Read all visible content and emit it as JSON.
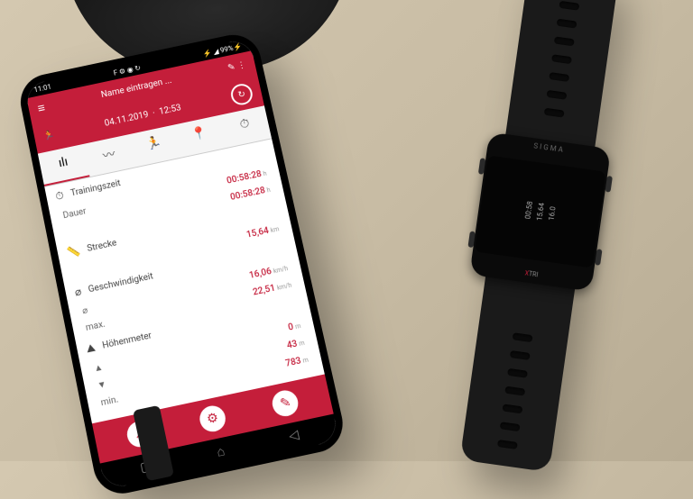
{
  "phone": {
    "status": {
      "time": "11:01",
      "icons": "F ⚙ ◉ ↻",
      "right": "⚡ ◢ 99%⚡"
    },
    "header": {
      "title": "Name eintragen ...",
      "right_icons": "✎ ⋮"
    },
    "datebar": {
      "date": "04.11.2019",
      "time": "12:53"
    },
    "tabs": [
      "ılı",
      "〰",
      "🏃",
      "📍",
      "⏱"
    ],
    "sections": [
      {
        "icon": "⏱",
        "title": "Trainingszeit",
        "rows": [
          {
            "label": "Dauer",
            "value": "00:58:28",
            "unit": "h"
          },
          {
            "label": "",
            "value": "00:58:28",
            "unit": "h"
          }
        ]
      },
      {
        "icon": "📏",
        "title": "Strecke",
        "rows": [
          {
            "label": "",
            "value": "15,64",
            "unit": "km"
          }
        ]
      },
      {
        "icon": "⌀",
        "title": "Geschwindigkeit",
        "rows": [
          {
            "label": "⌀",
            "value": "16,06",
            "unit": "km/h"
          },
          {
            "label": "max.",
            "value": "22,51",
            "unit": "km/h"
          }
        ]
      },
      {
        "icon": "⛰",
        "title": "Höhenmeter",
        "rows": [
          {
            "label": "▲",
            "value": "0",
            "unit": "m"
          },
          {
            "label": "▼",
            "value": "43",
            "unit": "m"
          },
          {
            "label": "min.",
            "value": "783",
            "unit": "m"
          }
        ]
      }
    ],
    "bottom_icons": [
      "↗",
      "⚙",
      "✎"
    ],
    "nav": [
      "⌂",
      "◁",
      "▢"
    ]
  },
  "watch": {
    "brand": "SIGMA",
    "model_prefix": "X",
    "model": "TRI",
    "screen_lines": [
      "00:58",
      "15.64",
      "16.0"
    ]
  }
}
